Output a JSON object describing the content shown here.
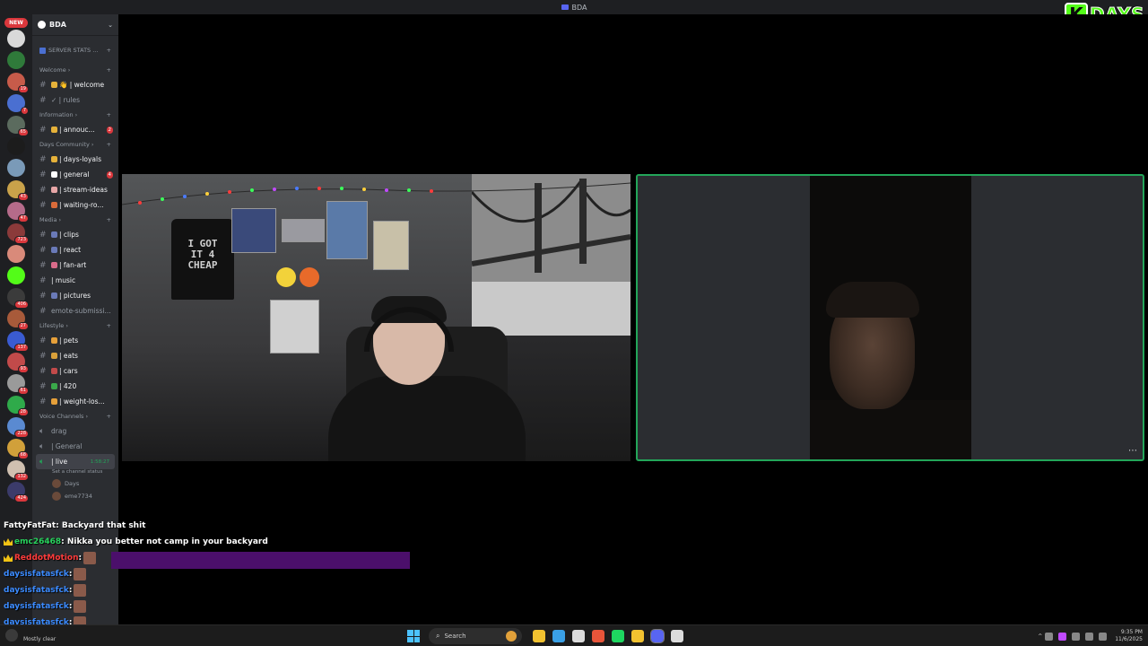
{
  "window": {
    "title": "BDA"
  },
  "overlay_logo": {
    "letter": "K",
    "text": "DAYS"
  },
  "server_rail": {
    "new_badge": "NEW",
    "servers": [
      {
        "color": "#d9d9d9",
        "badge": ""
      },
      {
        "color": "#2f7a3a",
        "badge": ""
      },
      {
        "color": "#c75b4a",
        "badge": "19"
      },
      {
        "color": "#4a6fd1",
        "badge": "7"
      },
      {
        "color": "#5b6b5e",
        "badge": "65"
      },
      {
        "color": "#1c1c1c",
        "badge": ""
      },
      {
        "color": "#7a9ab8",
        "badge": ""
      },
      {
        "color": "#c9a24a",
        "badge": "43"
      },
      {
        "color": "#b56b8a",
        "badge": "47"
      },
      {
        "color": "#8b3a3a",
        "badge": "723"
      },
      {
        "color": "#d98a7a",
        "badge": ""
      },
      {
        "color": "#53fc18",
        "badge": ""
      },
      {
        "color": "#3b3b3b",
        "badge": "406"
      },
      {
        "color": "#a85a3a",
        "badge": "27"
      },
      {
        "color": "#3a5bd1",
        "badge": "137"
      },
      {
        "color": "#c24a4a",
        "badge": "93"
      },
      {
        "color": "#9a9a9a",
        "badge": "61"
      },
      {
        "color": "#2faa4a",
        "badge": "28"
      },
      {
        "color": "#5a8ad1",
        "badge": "228"
      },
      {
        "color": "#d1a03a",
        "badge": "68"
      },
      {
        "color": "#d0c0b0",
        "badge": "132"
      },
      {
        "color": "#3b3b6a",
        "badge": "424"
      }
    ]
  },
  "sidebar": {
    "server_name": "BDA",
    "stats_label": "SERVER STATS ...",
    "categories": [
      {
        "name": "Welcome",
        "channels": [
          {
            "label": "👋 | welcome",
            "emoji_color": "#e6b23a",
            "badge": "",
            "bright": true
          },
          {
            "label": "✓ | rules",
            "emoji_color": "",
            "badge": "",
            "bright": false
          }
        ]
      },
      {
        "name": "Information",
        "channels": [
          {
            "label": "| annouc...",
            "emoji_color": "#e6b23a",
            "badge": "2",
            "bright": true
          }
        ]
      },
      {
        "name": "Days Community",
        "channels": [
          {
            "label": "| days-loyals",
            "emoji_color": "#e6b23a",
            "badge": "",
            "bright": true
          },
          {
            "label": "| general",
            "emoji_color": "#ffffff",
            "badge": "4",
            "bright": true
          },
          {
            "label": "| stream-ideas",
            "emoji_color": "#e6a6a6",
            "badge": "",
            "bright": true
          },
          {
            "label": "| waiting-ro...",
            "emoji_color": "#d96b3a",
            "badge": "",
            "bright": true
          }
        ]
      },
      {
        "name": "Media",
        "channels": [
          {
            "label": "| clips",
            "emoji_color": "#6a7ab8",
            "badge": "",
            "bright": true
          },
          {
            "label": "| react",
            "emoji_color": "#6a7ab8",
            "badge": "",
            "bright": true
          },
          {
            "label": "| fan-art",
            "emoji_color": "#d96b8a",
            "badge": "",
            "bright": true
          },
          {
            "label": "| music",
            "emoji_color": "",
            "badge": "",
            "bright": true
          },
          {
            "label": "| pictures",
            "emoji_color": "#6a7ab8",
            "badge": "",
            "bright": true
          },
          {
            "label": "emote-submissi...",
            "emoji_color": "",
            "badge": "",
            "bright": false
          }
        ]
      },
      {
        "name": "Lifestyle",
        "channels": [
          {
            "label": "| pets",
            "emoji_color": "#e6a03a",
            "badge": "",
            "bright": true
          },
          {
            "label": "| eats",
            "emoji_color": "#d9a03a",
            "badge": "",
            "bright": true
          },
          {
            "label": "| cars",
            "emoji_color": "#c24a4a",
            "badge": "",
            "bright": true
          },
          {
            "label": "| 420",
            "emoji_color": "#3aa84a",
            "badge": "",
            "bright": true
          },
          {
            "label": "| weight-los...",
            "emoji_color": "#e6a03a",
            "badge": "",
            "bright": true
          }
        ]
      }
    ],
    "voice": {
      "category": "Voice Channels",
      "channels": [
        {
          "label": "drag"
        },
        {
          "label": "| General"
        }
      ],
      "active": {
        "label": "| live",
        "time": "1:58:27",
        "status": "Set a channel status"
      },
      "users": [
        "Days",
        "eme7734"
      ]
    }
  },
  "chat": {
    "messages": [
      {
        "name": "FattyFatFat",
        "text": ": Backyard that shit",
        "style": ""
      },
      {
        "name": "emc26468",
        "text": ": Nikka you better not camp in your backyard",
        "style": "green"
      },
      {
        "name": "ReddotMotion",
        "text": ":",
        "style": "red"
      },
      {
        "name": "daysisfatasfck",
        "text": ":",
        "style": "blue"
      },
      {
        "name": "daysisfatasfck",
        "text": ":",
        "style": "blue"
      },
      {
        "name": "daysisfatasfck",
        "text": ":",
        "style": "blue"
      },
      {
        "name": "daysisfatasfck",
        "text": ":",
        "style": "blue"
      }
    ]
  },
  "user_panel": {
    "voice_status": "live / BDA",
    "username": "D...",
    "custom_status": "Mostly clear"
  },
  "taskbar": {
    "search_placeholder": "Search",
    "time": "9:35 PM",
    "date": "11/6/2025",
    "apps": [
      {
        "name": "file-explorer",
        "color": "#f2c230"
      },
      {
        "name": "vscode",
        "color": "#3aa0e6"
      },
      {
        "name": "terminal",
        "color": "#dcdcdc"
      },
      {
        "name": "brave",
        "color": "#e8553a"
      },
      {
        "name": "spotify",
        "color": "#1ed760"
      },
      {
        "name": "chrome",
        "color": "#f2c230"
      },
      {
        "name": "discord",
        "color": "#5865f2"
      },
      {
        "name": "obs",
        "color": "#dcdcdc"
      },
      {
        "name": "kick",
        "color": "#1c1c1c"
      }
    ]
  }
}
